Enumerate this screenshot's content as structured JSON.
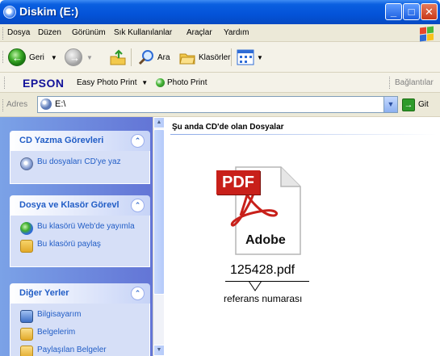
{
  "window": {
    "title": "Diskim (E:)",
    "min_label": "_",
    "max_label": "□",
    "close_label": "✕"
  },
  "menu": [
    "Dosya",
    "Düzen",
    "Görünüm",
    "Sık Kullanılanlar",
    "Araçlar",
    "Yardım"
  ],
  "toolbar": {
    "back": "Geri",
    "search": "Ara",
    "folders": "Klasörler"
  },
  "epson": {
    "brand": "EPSON",
    "easy_print": "Easy Photo Print",
    "photo_print": "Photo Print",
    "links": "Bağlantılar"
  },
  "address": {
    "label": "Adres",
    "value": "E:\\",
    "go": "Git"
  },
  "panels": [
    {
      "title": "CD Yazma Görevleri",
      "tasks": [
        "Bu dosyaları CD'ye yaz"
      ]
    },
    {
      "title": "Dosya ve Klasör Görevl",
      "tasks": [
        "Bu klasörü Web'de yayımla",
        "Bu klasörü paylaş"
      ]
    },
    {
      "title": "Diğer Yerler",
      "tasks": [
        "Bilgisayarım",
        "Belgelerim",
        "Paylaşılan Belgeler"
      ]
    }
  ],
  "main": {
    "section_title": "Şu anda CD'de olan Dosyalar",
    "file": {
      "icon_badge": "PDF",
      "icon_brand": "Adobe",
      "name": "125428.pdf"
    },
    "annotation": "referans numarası"
  },
  "colors": {
    "title_blue": "#0453d8",
    "sidebar_blue": "#7ba2e7",
    "link_blue": "#215dc6",
    "pdf_red": "#c8201a"
  }
}
